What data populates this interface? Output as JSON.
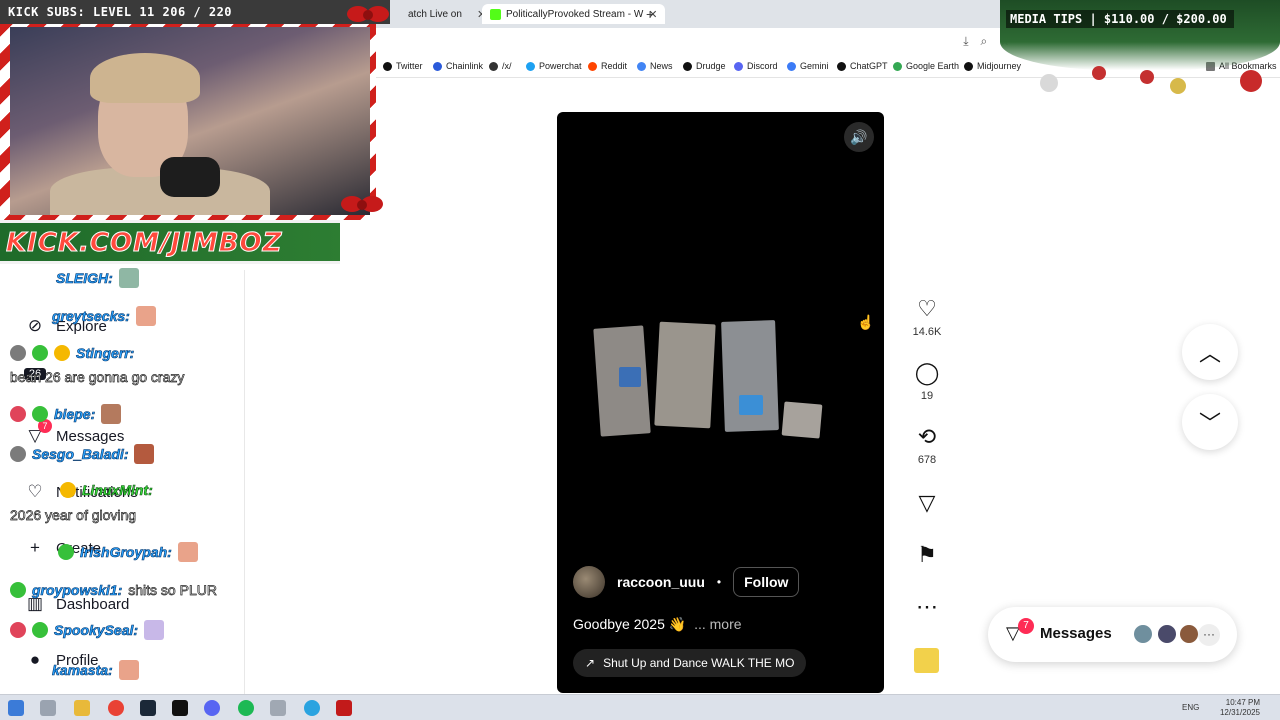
{
  "browser": {
    "tabs": [
      {
        "title": "atch Live on",
        "close": "✕"
      },
      {
        "title": "PoliticallyProvoked Stream - W",
        "close": "✕"
      }
    ],
    "new_tab": "+",
    "bookmarks": [
      {
        "label": "Twitter",
        "color": "#111111"
      },
      {
        "label": "Chainlink",
        "color": "#2a5ada"
      },
      {
        "label": "/x/",
        "color": "#333333"
      },
      {
        "label": "Powerchat",
        "color": "#1da1f2"
      },
      {
        "label": "Reddit",
        "color": "#ff4500"
      },
      {
        "label": "News",
        "color": "#4285f4"
      },
      {
        "label": "Drudge",
        "color": "#111111"
      },
      {
        "label": "Discord",
        "color": "#5865f2"
      },
      {
        "label": "Gemini",
        "color": "#3c7bf6"
      },
      {
        "label": "ChatGPT",
        "color": "#111111"
      },
      {
        "label": "Google Earth",
        "color": "#34a853"
      },
      {
        "label": "Midjourney",
        "color": "#111111"
      },
      {
        "label": "All Bookmarks",
        "color": "#777777"
      }
    ]
  },
  "stream_overlay": {
    "sub_goal": "KICK SUBS: LEVEL 11 206 / 220",
    "kick_url": "KICK.COM/JIMBOZ",
    "media_tips": "MEDIA TIPS | $110.00 / $200.00"
  },
  "sidebar": {
    "items": [
      {
        "label": "Explore",
        "icon": "compass-icon"
      },
      {
        "label": "Messages",
        "icon": "paper-plane-icon",
        "badge": "7"
      },
      {
        "label": "Notifications",
        "icon": "heart-icon"
      },
      {
        "label": "Create",
        "icon": "plus-icon"
      },
      {
        "label": "Dashboard",
        "icon": "dashboard-icon"
      },
      {
        "label": "Profile",
        "icon": "profile-icon"
      }
    ],
    "live_badge_text": "26"
  },
  "chat": [
    {
      "user": "SLEIGH:",
      "message": "",
      "green": false
    },
    {
      "user": "greytsecks:",
      "message": "",
      "green": false
    },
    {
      "user": "Stingerr:",
      "message": "bean 26 are gonna go crazy",
      "green": false
    },
    {
      "user": "biepe:",
      "message": "",
      "green": false
    },
    {
      "user": "Sesgo_Baladi:",
      "message": "",
      "green": false
    },
    {
      "user": "LinuxMint:",
      "message": "2026 year of gloving",
      "green": true
    },
    {
      "user": "IrishGroypah:",
      "message": "",
      "green": false
    },
    {
      "user": "groypowski1:",
      "message": "shits so PLUR",
      "green": false
    },
    {
      "user": "SpookySeal:",
      "message": "",
      "green": false
    },
    {
      "user": "kamasta:",
      "message": "",
      "green": false
    }
  ],
  "video": {
    "author": "raccoon_uuu",
    "separator": "•",
    "follow_label": "Follow",
    "caption": "Goodbye 2025 👋",
    "more_label": "... more",
    "music": "Shut Up and Dance  WALK THE MO",
    "music_icon": "↗",
    "sound_icon": "🔊"
  },
  "actions": {
    "likes": "14.6K",
    "comments": "19",
    "reposts": "678"
  },
  "messages_pill": {
    "label": "Messages",
    "badge": "7",
    "more": "···",
    "avatar_colors": [
      "#6f8f9e",
      "#4a4a6a",
      "#8a5a3c"
    ]
  },
  "taskbar": {
    "lang": "ENG",
    "time": "10:47 PM",
    "date": "12/31/2025"
  }
}
